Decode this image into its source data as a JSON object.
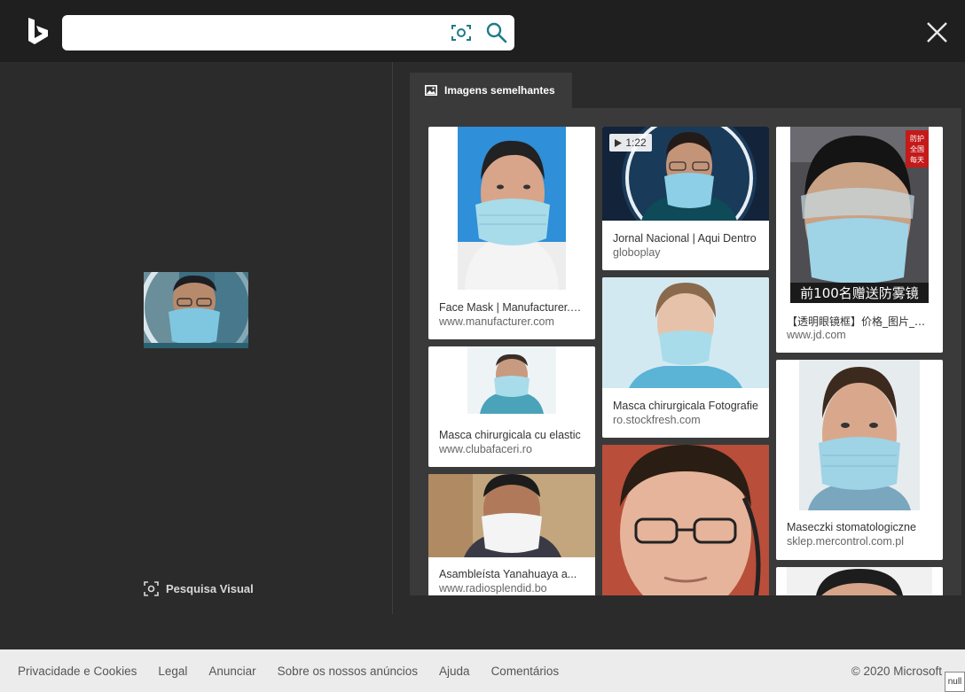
{
  "header": {
    "search_value": "",
    "icons": [
      "bing-logo-icon",
      "visual-search-icon",
      "search-icon",
      "close-icon"
    ]
  },
  "left": {
    "visual_search_label": "Pesquisa Visual"
  },
  "results": {
    "tab_label": "Imagens semelhantes",
    "cards": [
      {
        "title": "Face Mask | Manufacturer.com",
        "domain": "www.manufacturer.com"
      },
      {
        "title": "Masca chirurgicala cu elastic",
        "domain": "www.clubafaceri.ro"
      },
      {
        "title": "Asambleísta Yanahuaya a...",
        "domain": "www.radiosplendid.bo"
      },
      {
        "title": "Jornal Nacional | Aqui Dentro",
        "domain": "globoplay",
        "badge": "1:22"
      },
      {
        "title": "Masca chirurgicala Fotografie",
        "domain": "ro.stockfresh.com"
      },
      {
        "title": "【透明眼镜框】价格_图片_品牌",
        "domain": "www.jd.com"
      },
      {
        "title": "Maseczki stomatologiczne",
        "domain": "sklep.mercontrol.com.pl"
      }
    ],
    "thumb_text": "前100名赠送防雾镜",
    "thumb_corner_text": [
      "防护",
      "全国",
      "每天"
    ]
  },
  "footer": {
    "links": [
      "Privacidade e Cookies",
      "Legal",
      "Anunciar",
      "Sobre os nossos anúncios",
      "Ajuda",
      "Comentários"
    ],
    "copyright": "© 2020 Microsoft",
    "null_label": "null"
  },
  "colors": {
    "topbar": "#1f1f1f",
    "background": "#2b2b2b",
    "panel": "#3a3a3a",
    "search_accent": "#1e7a8c",
    "footer": "#ececec",
    "mask": "#9fd3e6"
  }
}
